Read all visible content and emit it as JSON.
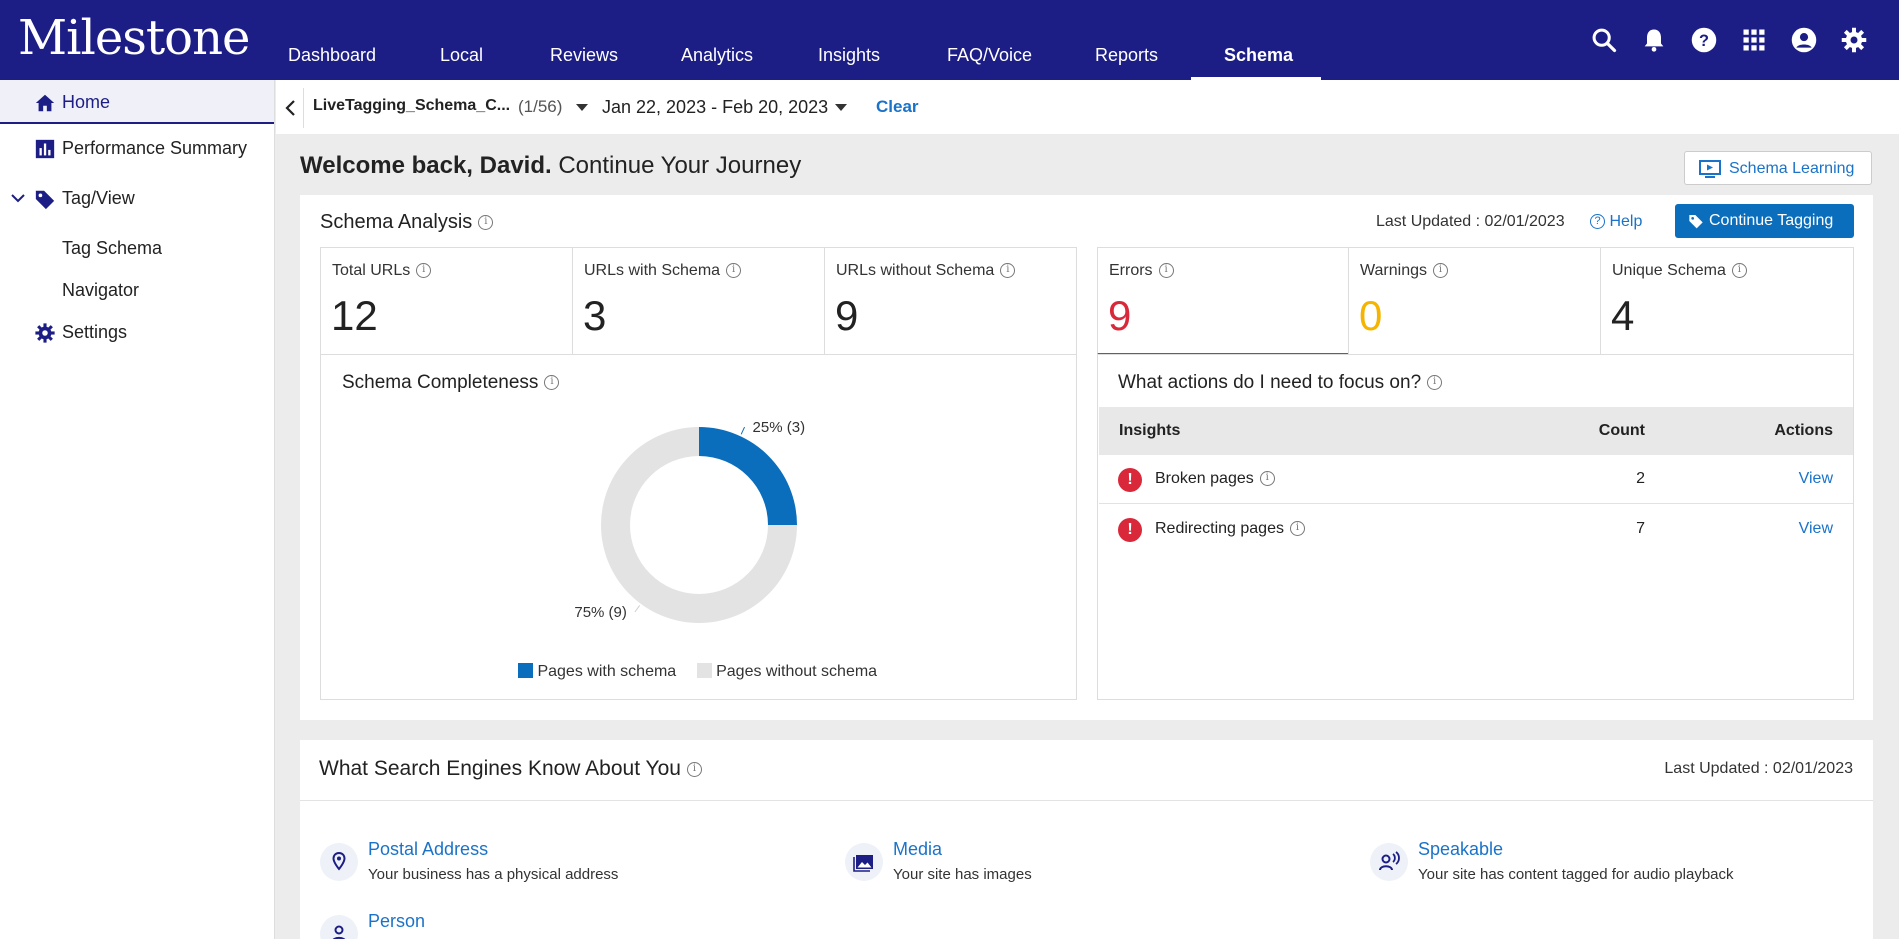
{
  "brand": {
    "name": "Milestone",
    "primary": "#1c1e85",
    "accent": "#0a6ebd",
    "link": "#1a73c9",
    "error": "#d9283a",
    "warning": "#f5b400"
  },
  "nav": {
    "items": [
      {
        "label": "Dashboard"
      },
      {
        "label": "Local"
      },
      {
        "label": "Reviews"
      },
      {
        "label": "Analytics"
      },
      {
        "label": "Insights"
      },
      {
        "label": "FAQ/Voice"
      },
      {
        "label": "Reports"
      },
      {
        "label": "Schema"
      }
    ],
    "active": "Schema",
    "icons": [
      "search-icon",
      "bell-icon",
      "help-icon",
      "apps-grid-icon",
      "account-icon",
      "gear-icon"
    ]
  },
  "sidebar": {
    "items": [
      {
        "label": "Home",
        "icon": "home-icon"
      },
      {
        "label": "Performance Summary",
        "icon": "bar-chart-icon"
      },
      {
        "label": "Tag/View",
        "icon": "tag-icon"
      },
      {
        "label": "Tag Schema"
      },
      {
        "label": "Navigator"
      },
      {
        "label": "Settings",
        "icon": "gear-icon"
      }
    ]
  },
  "filter": {
    "site": "LiveTagging_Schema_C...",
    "site_count": "(1/56)",
    "date_range": "Jan 22, 2023 - Feb 20, 2023",
    "clear_label": "Clear"
  },
  "welcome": {
    "bold": "Welcome back, David.",
    "rest": "Continue Your Journey",
    "learning_label": "Schema Learning"
  },
  "schema_analysis": {
    "title": "Schema Analysis",
    "last_updated": "Last Updated : 02/01/2023",
    "help_label": "Help",
    "continue_label": "Continue Tagging",
    "stats": [
      {
        "label": "Total URLs",
        "value": "12"
      },
      {
        "label": "URLs with Schema",
        "value": "3"
      },
      {
        "label": "URLs without Schema",
        "value": "9"
      },
      {
        "label": "Errors",
        "value": "9"
      },
      {
        "label": "Warnings",
        "value": "0"
      },
      {
        "label": "Unique Schema",
        "value": "4"
      }
    ],
    "completeness": {
      "title": "Schema Completeness",
      "slice_labels": [
        "25% (3)",
        "75% (9)"
      ],
      "legend": [
        "Pages with schema",
        "Pages without schema"
      ]
    },
    "actions": {
      "title": "What actions do I need to focus on?",
      "columns": [
        "Insights",
        "Count",
        "Actions"
      ],
      "rows": [
        {
          "insight": "Broken pages",
          "count": "2",
          "action": "View"
        },
        {
          "insight": "Redirecting pages",
          "count": "7",
          "action": "View"
        }
      ]
    }
  },
  "search_engines": {
    "title": "What Search Engines Know About You",
    "last_updated": "Last Updated : 02/01/2023",
    "items": [
      {
        "title": "Postal Address",
        "desc": "Your business has a physical address",
        "icon": "location-pin-icon"
      },
      {
        "title": "Media",
        "desc": "Your site has images",
        "icon": "image-icon"
      },
      {
        "title": "Speakable",
        "desc": "Your site has content tagged for audio playback",
        "icon": "speaker-icon"
      },
      {
        "title": "Person",
        "desc": "",
        "icon": "person-icon"
      }
    ]
  },
  "chart_data": {
    "type": "pie",
    "categories": [
      "Pages with schema",
      "Pages without schema"
    ],
    "values": [
      3,
      9
    ],
    "percent": [
      25,
      75
    ],
    "colors": [
      "#0a6ebd",
      "#e3e3e3"
    ],
    "title": "Schema Completeness",
    "legend_position": "bottom"
  }
}
